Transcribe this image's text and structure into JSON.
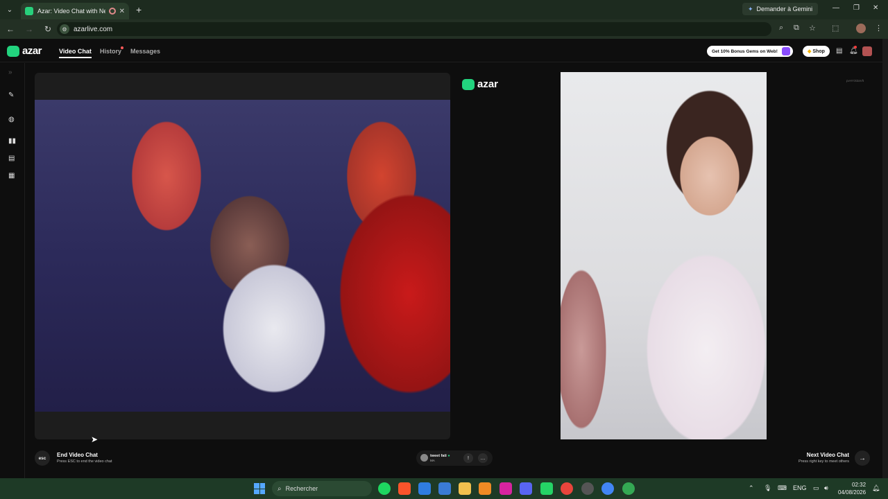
{
  "browser": {
    "tab_title": "Azar: Video Chat with New",
    "tab_close": "✕",
    "new_tab": "+",
    "gemini_button": "Demander à Gemini",
    "url": "azarlive.com"
  },
  "header": {
    "brand": "azar",
    "nav": [
      "Video Chat",
      "History",
      "Messages"
    ],
    "promo": "Get 10% Bonus Gems on Web!",
    "shop": "Shop"
  },
  "remote": {
    "brand": "azar",
    "corner_id": "pvHY3t3aVlt"
  },
  "controls": {
    "esc_label": "esc",
    "end_title": "End Video Chat",
    "end_sub": "Press ESC to end the video chat",
    "partner_name": "tweet fati",
    "partner_country": "MA",
    "next_title": "Next Video Chat",
    "next_sub": "Press right key to meet others"
  },
  "taskbar": {
    "search_placeholder": "Rechercher",
    "lang": "ENG",
    "time": "02:32",
    "date": "04/08/2026"
  },
  "colors": {
    "brand_green": "#22d37e",
    "taskbar": "#1e3a26",
    "chrome_bg": "#1d2b1f"
  },
  "icons": [
    "chevron-down-icon",
    "favicon-icon",
    "record-icon",
    "close-icon",
    "plus-icon",
    "sparkle-icon",
    "minimize-icon",
    "maximize-icon",
    "back-icon",
    "forward-icon",
    "reload-icon",
    "zoom-icon",
    "install-icon",
    "bookmark-star-icon",
    "extensions-icon",
    "menu-dots-icon",
    "gift-icon",
    "gem-icon",
    "inbox-icon",
    "bell-icon",
    "magic-wand-icon",
    "edit-icon",
    "layout-split-icon",
    "layout-stack-icon",
    "layout-grid-icon",
    "report-icon",
    "chat-icon",
    "arrow-right-icon",
    "windows-start-icon",
    "search-icon"
  ]
}
